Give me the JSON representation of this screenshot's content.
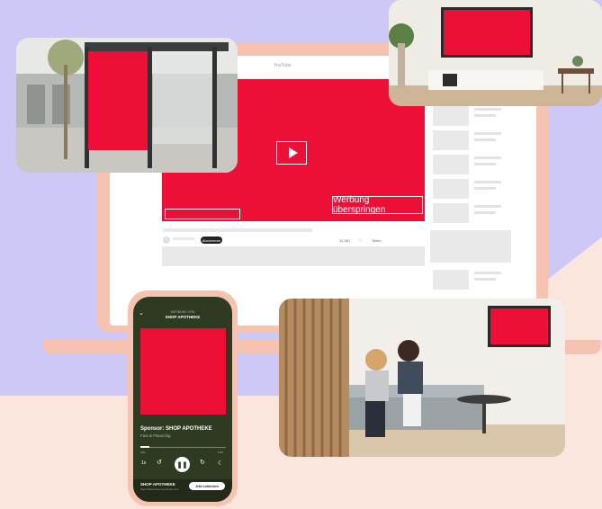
{
  "colors": {
    "ad_red": "#ee0f36",
    "lavender": "#cdc8f6",
    "peach": "#fbe6de",
    "salmon": "#f6c3b1"
  },
  "laptop": {
    "site_logo": "YouTube",
    "skip_button": "Werbung überspringen",
    "subscribe": "Abonnieren",
    "likes": "12,381",
    "share": "Teilen",
    "play_icon": "play-icon"
  },
  "phone": {
    "top_label": "WERBUNG VON",
    "top_brand": "SHOP APOTHEKE",
    "title": "Sponsor: SHOP APOTHEKE",
    "subtitle": "Fast & Flauschig",
    "time_elapsed": "0:01",
    "time_total": "0:30",
    "speed": "1x",
    "shop_name": "SHOP APOTHEKE",
    "shop_url": "https://www.shop-apotheke.com",
    "cta": "Jetzt entdecken"
  },
  "photos": {
    "bus": "Bus stop billboard",
    "room": "Living room TV",
    "lounge": "Waiting room screen"
  }
}
